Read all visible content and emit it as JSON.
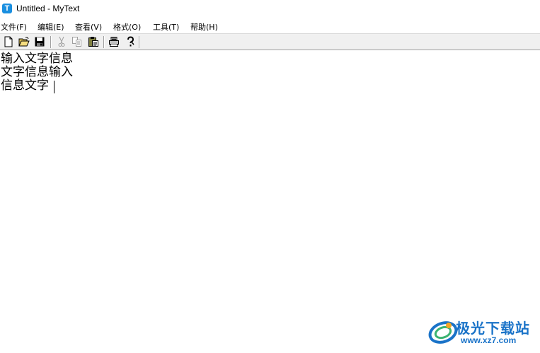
{
  "window": {
    "title": "Untitled - MyText",
    "icon": "mytext-app-icon",
    "icon_letter": "T"
  },
  "menubar": {
    "items": [
      {
        "label": "文件(F)"
      },
      {
        "label": "编辑(E)"
      },
      {
        "label": "查看(V)"
      },
      {
        "label": "格式(O)"
      },
      {
        "label": "工具(T)"
      },
      {
        "label": "帮助(H)"
      }
    ]
  },
  "toolbar": {
    "buttons": [
      {
        "icon": "new-file-icon",
        "enabled": true
      },
      {
        "icon": "open-folder-icon",
        "enabled": true
      },
      {
        "icon": "save-icon",
        "enabled": true
      },
      {
        "icon": "cut-icon",
        "enabled": false
      },
      {
        "icon": "copy-icon",
        "enabled": false
      },
      {
        "icon": "paste-icon",
        "enabled": true
      },
      {
        "icon": "print-icon",
        "enabled": true
      },
      {
        "icon": "help-icon",
        "enabled": true
      }
    ]
  },
  "editor": {
    "lines": [
      "输入文字信息",
      "文字信息输入",
      "信息文字"
    ]
  },
  "watermark": {
    "title": "极光下载站",
    "url": "www.xz7.com",
    "accent_color": "#1a73c8"
  }
}
